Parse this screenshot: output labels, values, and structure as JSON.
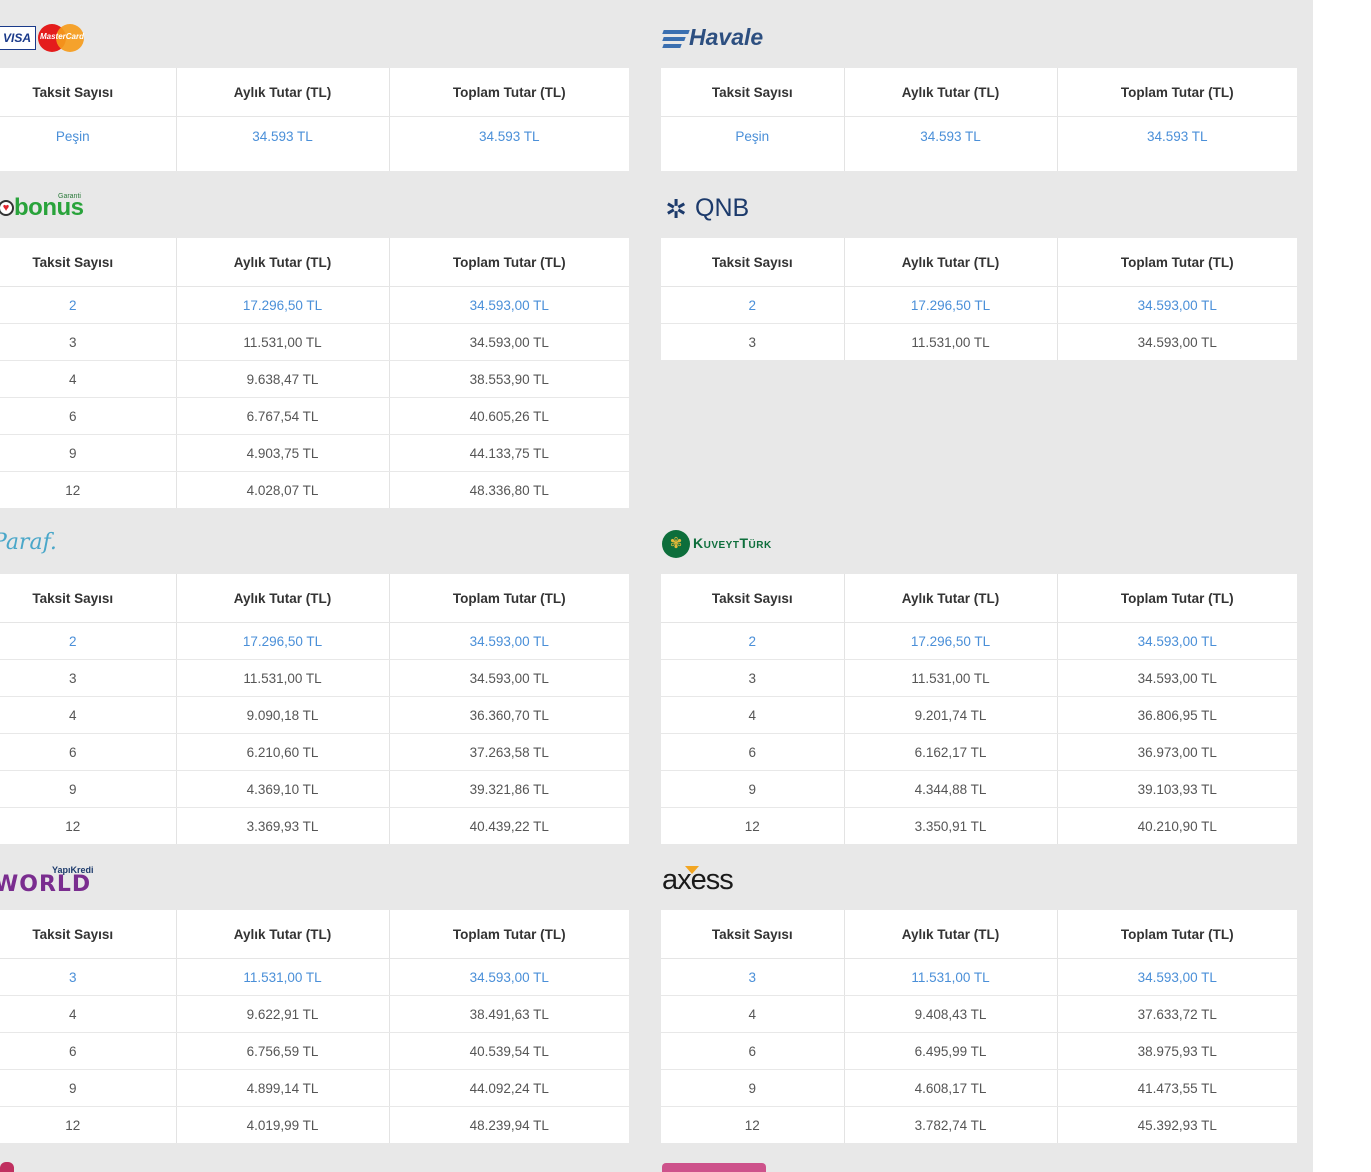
{
  "headers": [
    "Taksit Sayısı",
    "Aylık Tutar (TL)",
    "Toplam Tutar (TL)"
  ],
  "banks": {
    "card": {
      "logo": {
        "visa": "VISA",
        "mastercard": "MasterCard"
      },
      "rows": [
        [
          "Peşin",
          "34.593 TL",
          "34.593 TL"
        ]
      ]
    },
    "havale": {
      "logo": "Havale",
      "rows": [
        [
          "Peşin",
          "34.593 TL",
          "34.593 TL"
        ]
      ]
    },
    "bonus": {
      "logo": {
        "brand": "bonus",
        "bank": "Garanti"
      },
      "rows": [
        [
          "2",
          "17.296,50 TL",
          "34.593,00 TL"
        ],
        [
          "3",
          "11.531,00 TL",
          "34.593,00 TL"
        ],
        [
          "4",
          "9.638,47 TL",
          "38.553,90 TL"
        ],
        [
          "6",
          "6.767,54 TL",
          "40.605,26 TL"
        ],
        [
          "9",
          "4.903,75 TL",
          "44.133,75 TL"
        ],
        [
          "12",
          "4.028,07 TL",
          "48.336,80 TL"
        ]
      ]
    },
    "qnb": {
      "logo": "QNB",
      "rows": [
        [
          "2",
          "17.296,50 TL",
          "34.593,00 TL"
        ],
        [
          "3",
          "11.531,00 TL",
          "34.593,00 TL"
        ]
      ]
    },
    "paraf": {
      "logo": "Paraf.",
      "rows": [
        [
          "2",
          "17.296,50 TL",
          "34.593,00 TL"
        ],
        [
          "3",
          "11.531,00 TL",
          "34.593,00 TL"
        ],
        [
          "4",
          "9.090,18 TL",
          "36.360,70 TL"
        ],
        [
          "6",
          "6.210,60 TL",
          "37.263,58 TL"
        ],
        [
          "9",
          "4.369,10 TL",
          "39.321,86 TL"
        ],
        [
          "12",
          "3.369,93 TL",
          "40.439,22 TL"
        ]
      ]
    },
    "kuveyt": {
      "logo": "KuveytTürk",
      "rows": [
        [
          "2",
          "17.296,50 TL",
          "34.593,00 TL"
        ],
        [
          "3",
          "11.531,00 TL",
          "34.593,00 TL"
        ],
        [
          "4",
          "9.201,74 TL",
          "36.806,95 TL"
        ],
        [
          "6",
          "6.162,17 TL",
          "36.973,00 TL"
        ],
        [
          "9",
          "4.344,88 TL",
          "39.103,93 TL"
        ],
        [
          "12",
          "3.350,91 TL",
          "40.210,90 TL"
        ]
      ]
    },
    "world": {
      "logo": {
        "brand": "WORLD",
        "bank": "YapıKredi"
      },
      "rows": [
        [
          "3",
          "11.531,00 TL",
          "34.593,00 TL"
        ],
        [
          "4",
          "9.622,91 TL",
          "38.491,63 TL"
        ],
        [
          "6",
          "6.756,59 TL",
          "40.539,54 TL"
        ],
        [
          "9",
          "4.899,14 TL",
          "44.092,24 TL"
        ],
        [
          "12",
          "4.019,99 TL",
          "48.239,94 TL"
        ]
      ]
    },
    "axess": {
      "logo": "axess",
      "rows": [
        [
          "3",
          "11.531,00 TL",
          "34.593,00 TL"
        ],
        [
          "4",
          "9.408,43 TL",
          "37.633,72 TL"
        ],
        [
          "6",
          "6.495,99 TL",
          "38.975,93 TL"
        ],
        [
          "9",
          "4.608,17 TL",
          "41.473,55 TL"
        ],
        [
          "12",
          "3.782,74 TL",
          "45.392,93 TL"
        ]
      ]
    }
  },
  "colors": {
    "link_blue": "#4a8fd8",
    "panel_bg": "#e8e8e8",
    "havale_blue": "#3a6fb0",
    "qnb_navy": "#1c3a6b",
    "kuveyt_green": "#0d6e3b",
    "world_purple": "#7a2d8f",
    "bonus_green": "#29a33b"
  }
}
